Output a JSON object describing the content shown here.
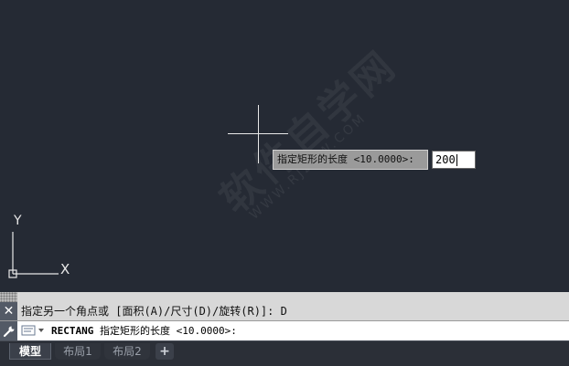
{
  "dynamic_prompt": {
    "label": "指定矩形的长度 <10.0000>:",
    "input_value": "200"
  },
  "ucs": {
    "y_label": "Y",
    "x_label": "X"
  },
  "watermark": {
    "main": "软件自学网",
    "sub": "WWW.RJZXW.COM"
  },
  "command": {
    "history": "指定另一个角点或 [面积(A)/尺寸(D)/旋转(R)]: D",
    "close_label": "✕",
    "current_command": "RECTANG",
    "current_prompt": "指定矩形的长度 <10.0000>:"
  },
  "tabs": {
    "model": "模型",
    "layout1": "布局1",
    "layout2": "布局2",
    "add": "+"
  },
  "colors": {
    "background": "#252a34",
    "crosshair": "#e8e8e8",
    "command_panel": "#d8d8d8"
  }
}
